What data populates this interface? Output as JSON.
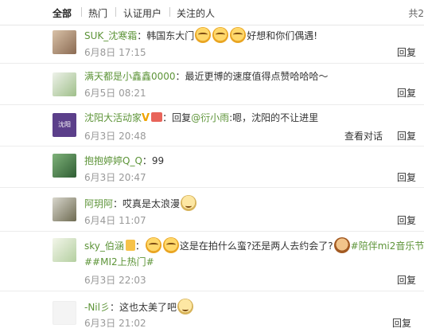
{
  "tabs": [
    "全部",
    "热门",
    "认证用户",
    "关注的人"
  ],
  "total_label": "共2",
  "reply_label": "回复",
  "view_conversation_label": "查看对话",
  "comments": [
    {
      "user": "SUK_沈寒霜",
      "text_before": "：韩国东大门",
      "text_after": "好想和你们偶遇!",
      "time": "6月8日 17:15"
    },
    {
      "user": "满天都是小鑫鑫0000",
      "text": "：最近更博的速度值得点赞哈哈哈～",
      "time": "6月5日 08:21"
    },
    {
      "user": "沈阳大活动家",
      "text_prefix": "：回复",
      "mention": "@衍小雨",
      "text_suffix": ":嗯，沈阳的不让进里",
      "time": "6月3日 20:48"
    },
    {
      "user": "抱抱婷婷Q_Q",
      "text": "：99",
      "time": "6月3日 20:47"
    },
    {
      "user": "阿玥阿",
      "text": "：哎真是太浪漫",
      "time": "6月4日 11:07"
    },
    {
      "user": "sky_伯涵",
      "text_before": "：",
      "text_mid": "这是在拍什么蛮?还是两人去约会了?",
      "topic": "#陪伴mi2音乐节",
      "line2": "##MI2上热门#",
      "time": "6月3日 22:03"
    },
    {
      "user": "-Nil彡",
      "text": "：这也太美了吧",
      "time": "6月3日 21:02"
    }
  ],
  "avatar_text_3": "沈阳",
  "colors": {
    "link": "#5d9438",
    "time": "#999999",
    "divider": "#ececec"
  }
}
